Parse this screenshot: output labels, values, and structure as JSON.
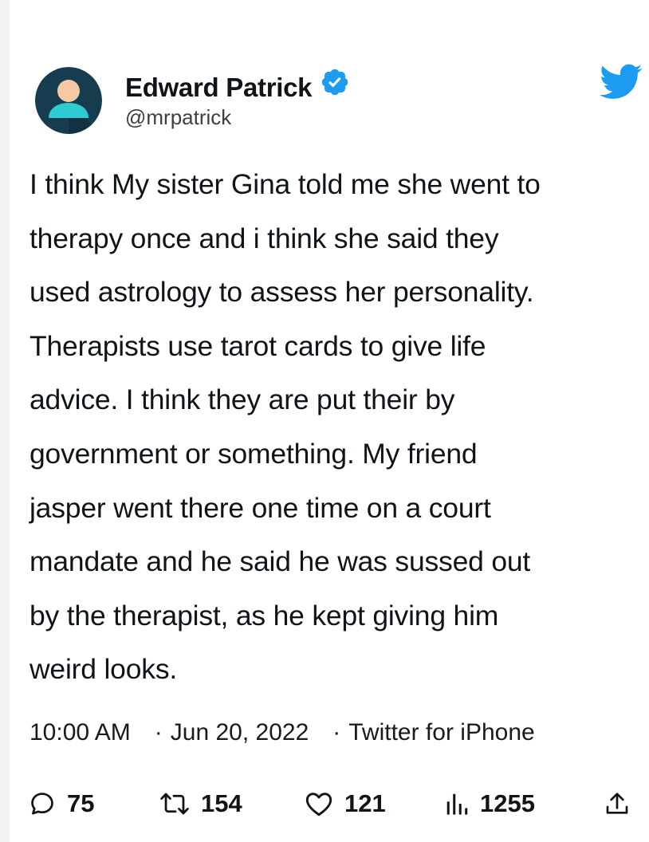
{
  "author": {
    "display_name": "Edward Patrick",
    "handle": "@mrpatrick",
    "verified": true
  },
  "tweet": {
    "text": "I think My sister Gina told me she went to\ntherapy once and i think she said they\nused astrology to assess her personality.\nTherapists use tarot cards to give life\nadvice. I think they are put their by\ngovernment or something. My friend\njasper went there one time on a court\nmandate and he said he was sussed out\nby the therapist, as he kept giving him\nweird looks.",
    "time": "10:00 AM",
    "separator": "·",
    "date": "Jun 20, 2022",
    "source": "Twitter for iPhone"
  },
  "stats": {
    "replies": "75",
    "retweets": "154",
    "likes": "121",
    "views": "1255"
  },
  "icons": {
    "avatar": "avatar-icon",
    "verified": "verified-badge-icon",
    "logo": "twitter-bird-icon",
    "reply": "reply-icon",
    "retweet": "retweet-icon",
    "like": "heart-icon",
    "views": "views-icon",
    "share": "share-icon"
  },
  "colors": {
    "twitter_blue": "#1d9bf0",
    "text": "#0f1419",
    "avatar_bg": "#173c4f",
    "avatar_body": "#2ecbd0",
    "avatar_head": "#f5c9a4"
  }
}
